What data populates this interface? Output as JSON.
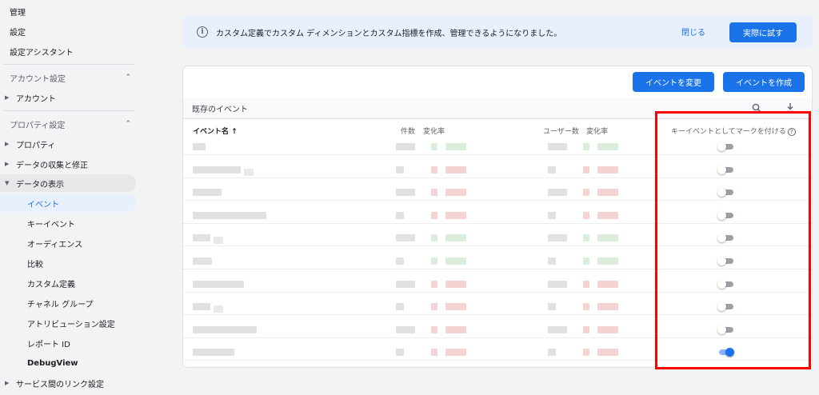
{
  "sidebar": {
    "top_items": [
      "管理",
      "設定",
      "設定アシスタント"
    ],
    "account_section": "アカウント設定",
    "account_item": "アカウント",
    "property_section": "プロパティ設定",
    "property_item": "プロパティ",
    "data_collection": "データの収集と修正",
    "data_display": "データの表示",
    "sub_items": [
      "イベント",
      "キーイベント",
      "オーディエンス",
      "比較",
      "カスタム定義",
      "チャネル グループ",
      "アトリビューション設定",
      "レポート ID",
      "DebugView"
    ],
    "service_links": "サービス間のリンク設定",
    "active_item": "イベント"
  },
  "banner": {
    "text": "カスタム定義でカスタム ディメンションとカスタム指標を作成、管理できるようになりました。",
    "close_label": "閉じる",
    "try_label": "実際に試す"
  },
  "card": {
    "modify_event_label": "イベントを変更",
    "create_event_label": "イベントを作成",
    "existing_label": "既存のイベント",
    "columns": {
      "event_name": "イベント名 ↑",
      "count": "件数",
      "change_rate": "変化率",
      "users": "ユーザー数",
      "user_change_rate": "変化率",
      "mark_key_event": "キーイベントとしてマークを付ける"
    },
    "rows": [
      {
        "key_event": false
      },
      {
        "key_event": false
      },
      {
        "key_event": false
      },
      {
        "key_event": false
      },
      {
        "key_event": false
      },
      {
        "key_event": false
      },
      {
        "key_event": false
      },
      {
        "key_event": false
      },
      {
        "key_event": false
      },
      {
        "key_event": true
      }
    ]
  },
  "colors": {
    "accent": "#1a73e8",
    "highlight": "#ff0000"
  },
  "icons": [
    "chevron-up-icon",
    "info-icon",
    "search-icon",
    "download-icon",
    "help-icon",
    "toggle-switch"
  ]
}
